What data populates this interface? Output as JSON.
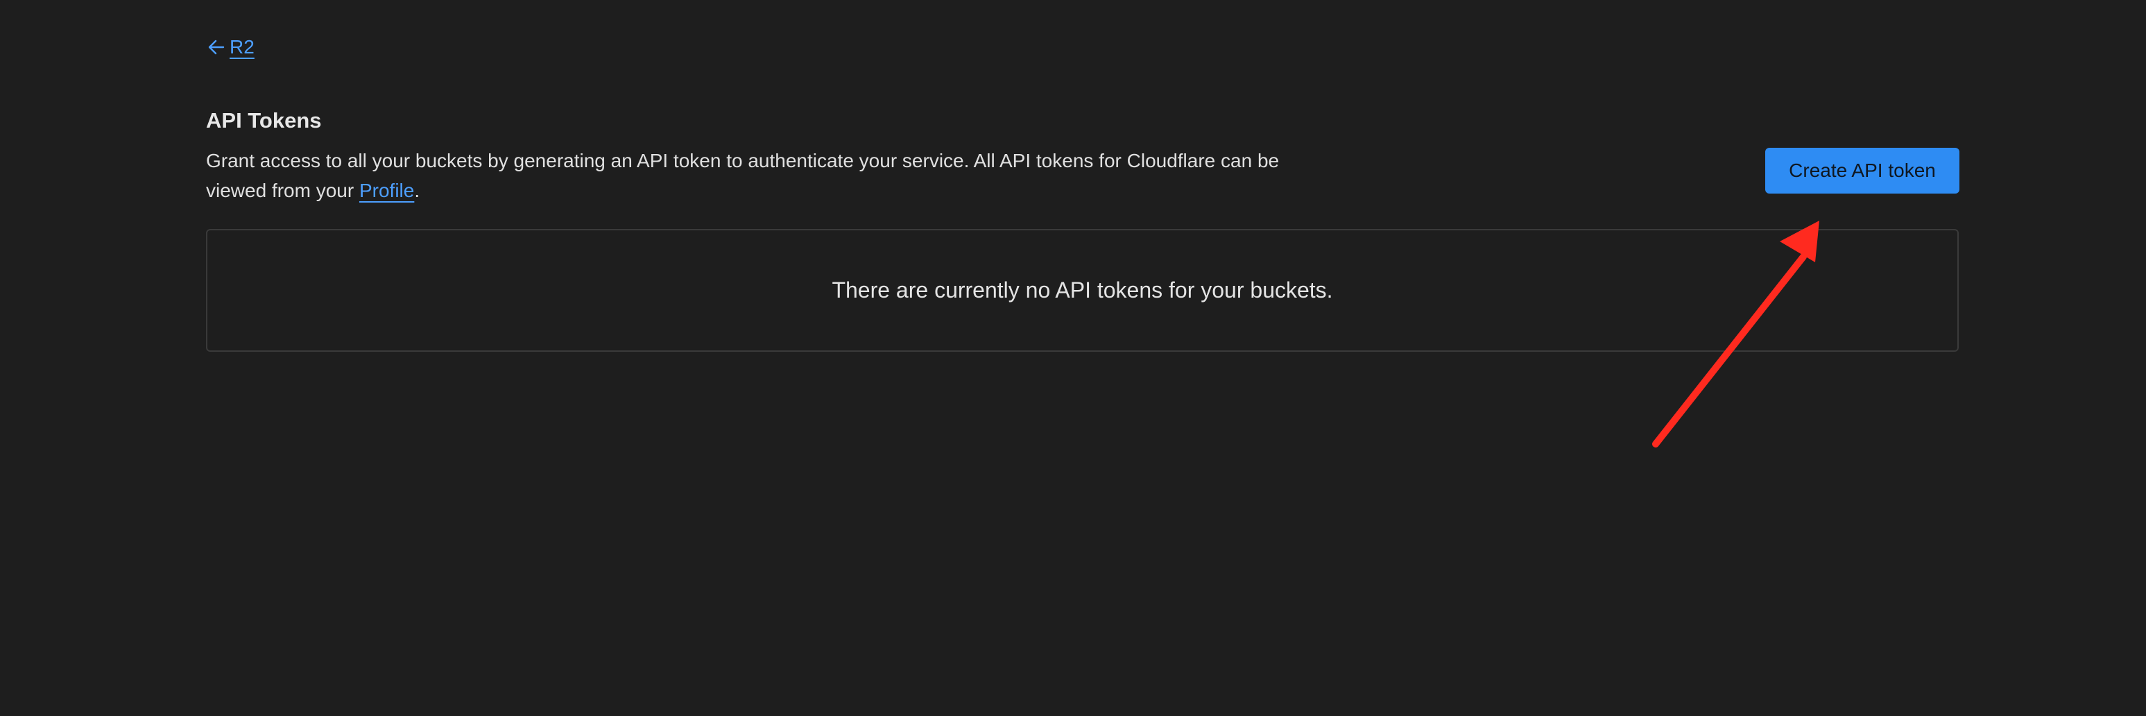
{
  "breadcrumb": {
    "back_label": "R2",
    "icon": "arrow-left-icon"
  },
  "section": {
    "title": "API Tokens",
    "description_text": "Grant access to all your buckets by generating an API token to authenticate your service. All API tokens for Cloudflare can be viewed from your ",
    "profile_link": "Profile",
    "description_end": "."
  },
  "actions": {
    "create_label": "Create API token"
  },
  "empty_state": {
    "message": "There are currently no API tokens for your buckets."
  },
  "colors": {
    "background": "#1e1e1e",
    "accent": "#2e8cf3",
    "link": "#4d9fff",
    "annotation_arrow": "#ff2a1f"
  }
}
